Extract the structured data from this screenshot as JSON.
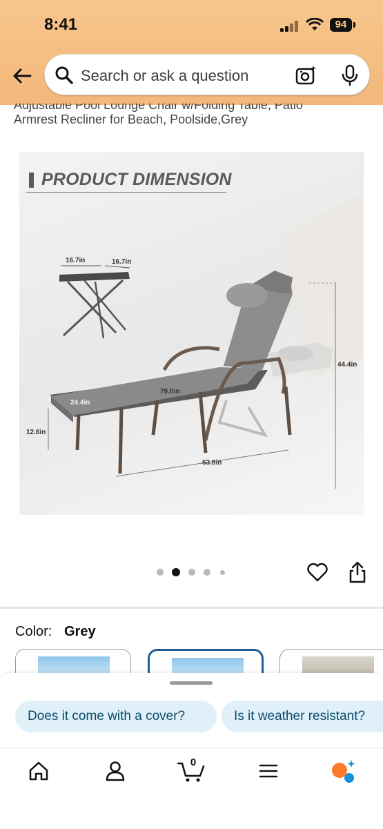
{
  "status_bar": {
    "time": "8:41",
    "battery": "94"
  },
  "search": {
    "placeholder": "Search or ask a question"
  },
  "product": {
    "title_line1": "Adjustable Pool Lounge Chair w/Folding Table, Patio",
    "title_line2": "Armrest Recliner for Beach, Poolside,Grey"
  },
  "image": {
    "heading": "PRODUCT DIMENSION",
    "dimensions": {
      "table_width": "16.7in",
      "table_depth": "16.7in",
      "back_height": "44.4in",
      "cushion_length": "79.0in",
      "cushion_width": "24.4in",
      "seat_height": "12.6in",
      "frame_length": "63.8in"
    },
    "carousel": {
      "total": 5,
      "active": 2
    }
  },
  "color": {
    "label": "Color:",
    "value": "Grey"
  },
  "suggestions": [
    "Does it come with a cover?",
    "Is it weather resistant?"
  ],
  "tabbar": {
    "cart_count": "0",
    "items": [
      "home-icon",
      "account-icon",
      "cart-icon",
      "menu-icon",
      "rufus-icon"
    ]
  },
  "colors": {
    "header": "#f7c68c",
    "selected": "#1f5d9a",
    "chip_bg": "#e0f0f8",
    "chip_text": "#0c4a6e"
  }
}
